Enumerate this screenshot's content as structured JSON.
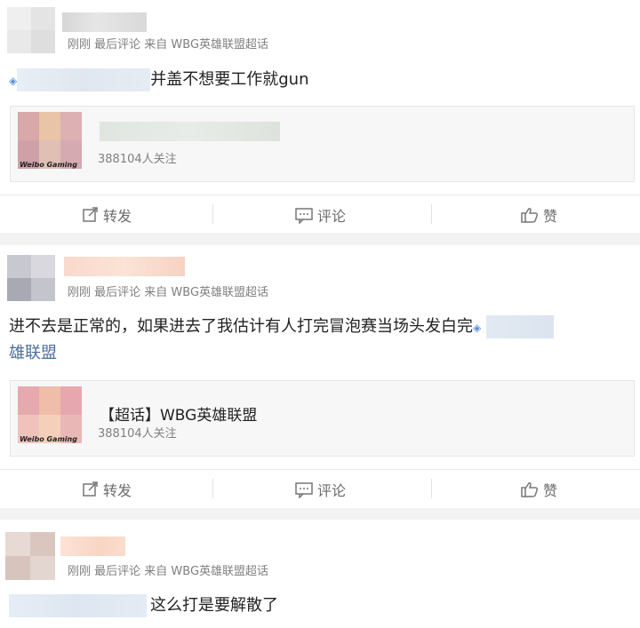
{
  "posts": [
    {
      "meta": "刚刚 最后评论 来自 WBG英雄联盟超话",
      "text": "并盖不想要工作就gun",
      "card": {
        "title": "",
        "followers": "388104人关注",
        "thumb_text": "Weibo Gaming"
      },
      "actions": {
        "repost": "转发",
        "comment": "评论",
        "like": "赞"
      }
    },
    {
      "meta": "刚刚 最后评论 来自 WBG英雄联盟超话",
      "text": "进不去是正常的，如果进去了我估计有人打完冒泡赛当场头发白完",
      "text_tail": "雄联盟",
      "card": {
        "title": "【超话】WBG英雄联盟",
        "followers": "388104人关注",
        "thumb_text": "Weibo Gaming"
      },
      "actions": {
        "repost": "转发",
        "comment": "评论",
        "like": "赞"
      }
    },
    {
      "meta": "刚刚 最后评论 来自 WBG英雄联盟超话",
      "text": "这么打是要解散了"
    }
  ],
  "colors": {
    "link": "#4b6f9a",
    "meta": "#808080",
    "divider": "#f2f2f2"
  },
  "icons": {
    "repost": "repost-icon",
    "comment": "comment-icon",
    "like": "thumbs-up-icon",
    "super_topic": "diamond-icon"
  }
}
